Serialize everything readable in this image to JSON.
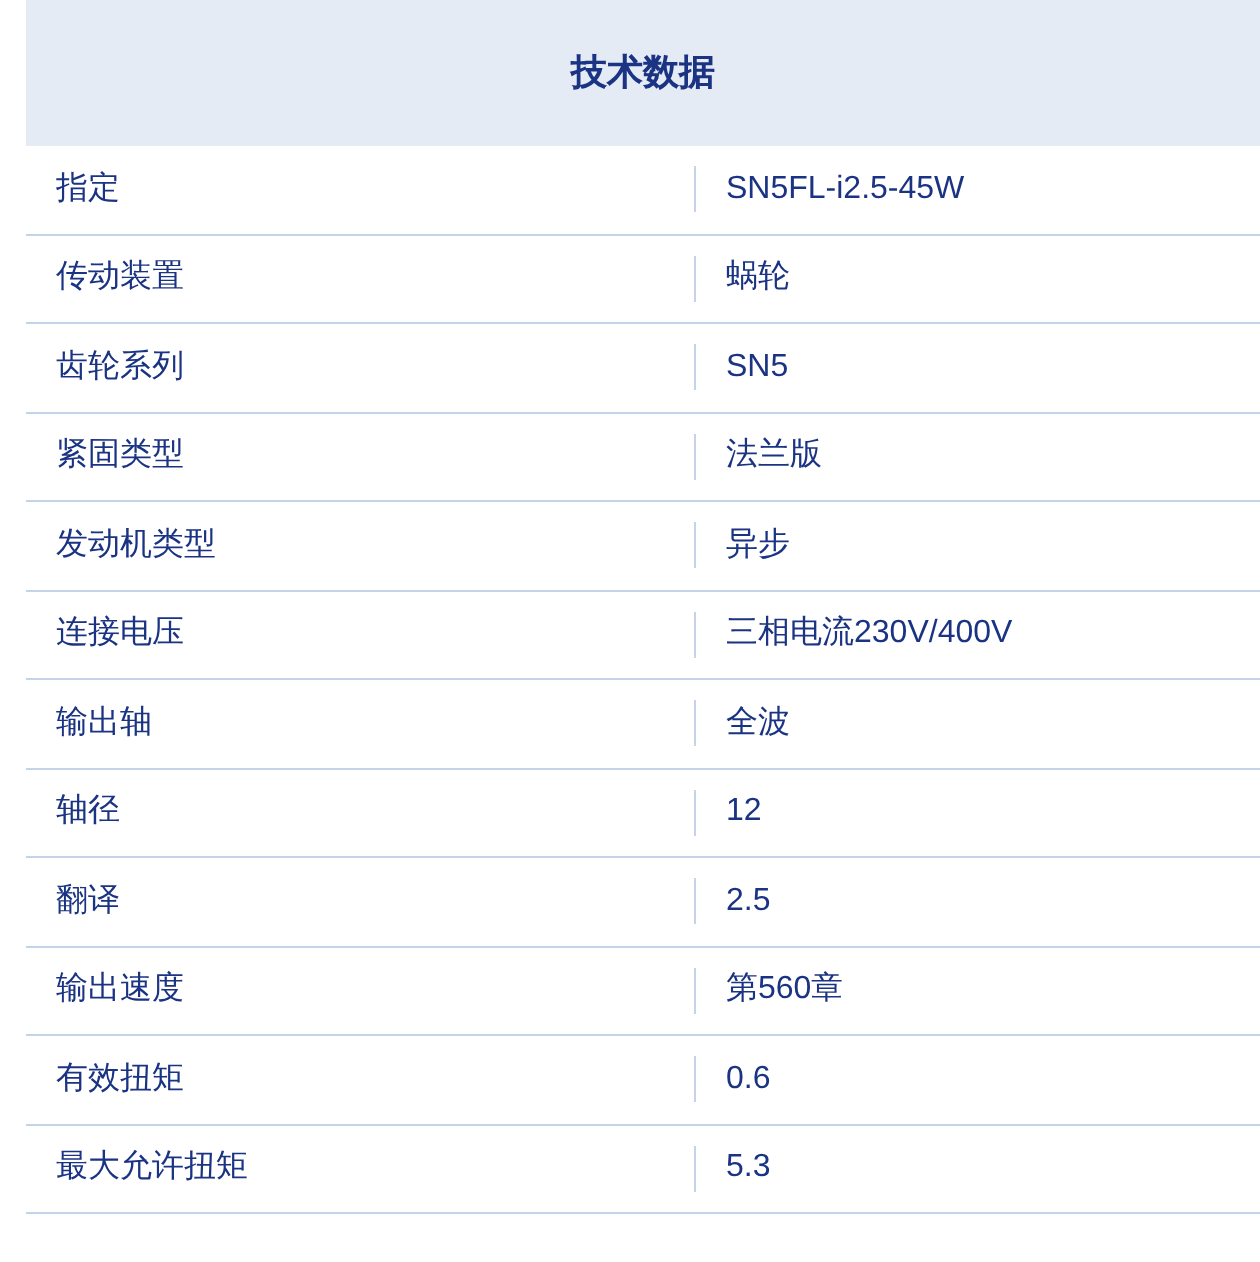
{
  "table": {
    "title": "技术数据",
    "rows": [
      {
        "label": "指定",
        "value": "SN5FL-i2.5-45W"
      },
      {
        "label": "传动装置",
        "value": "蜗轮"
      },
      {
        "label": "齿轮系列",
        "value": "SN5"
      },
      {
        "label": "紧固类型",
        "value": "法兰版"
      },
      {
        "label": "发动机类型",
        "value": "异步"
      },
      {
        "label": "连接电压",
        "value": "三相电流230V/400V"
      },
      {
        "label": "输出轴",
        "value": "全波"
      },
      {
        "label": "轴径",
        "value": "12"
      },
      {
        "label": "翻译",
        "value": "2.5"
      },
      {
        "label": "输出速度",
        "value": "第560章"
      },
      {
        "label": "有效扭矩",
        "value": "0.6"
      },
      {
        "label": "最大允许扭矩",
        "value": "5.3"
      }
    ]
  }
}
